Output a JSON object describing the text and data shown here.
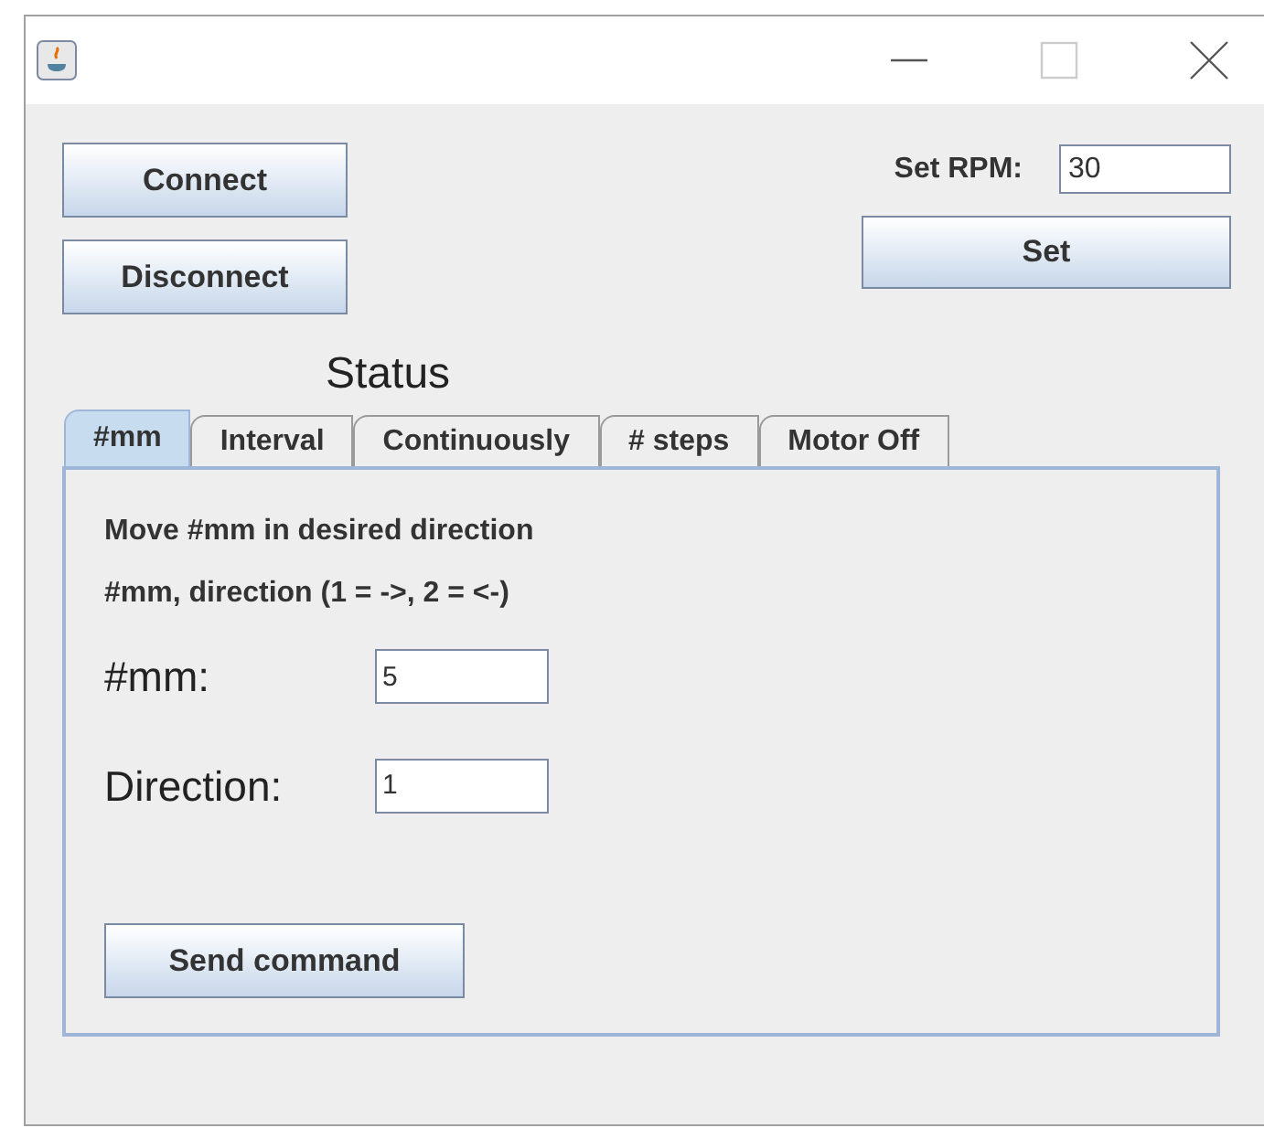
{
  "window": {
    "title_bar": {
      "buttons": [
        {
          "kind": "minimize"
        },
        {
          "kind": "maximize"
        },
        {
          "kind": "close"
        }
      ]
    }
  },
  "connection": {
    "buttons": [
      "Connect",
      "Disconnect"
    ]
  },
  "rpm": {
    "label": "Set RPM:",
    "value": "30",
    "button": "Set"
  },
  "status": "Status",
  "tabs": [
    {
      "label": "#mm",
      "selected": true
    },
    {
      "label": "Interval",
      "selected": false
    },
    {
      "label": "Continuously",
      "selected": false
    },
    {
      "label": "# steps",
      "selected": false
    },
    {
      "label": "Motor Off",
      "selected": false
    }
  ],
  "panel": {
    "heading": "Move #mm in desired direction",
    "hint": "#mm, direction (1 = ->, 2 = <-)",
    "fields": [
      {
        "label": "#mm:",
        "value": "5"
      },
      {
        "label": "Direction:",
        "value": "1"
      }
    ],
    "button": "Send command"
  }
}
